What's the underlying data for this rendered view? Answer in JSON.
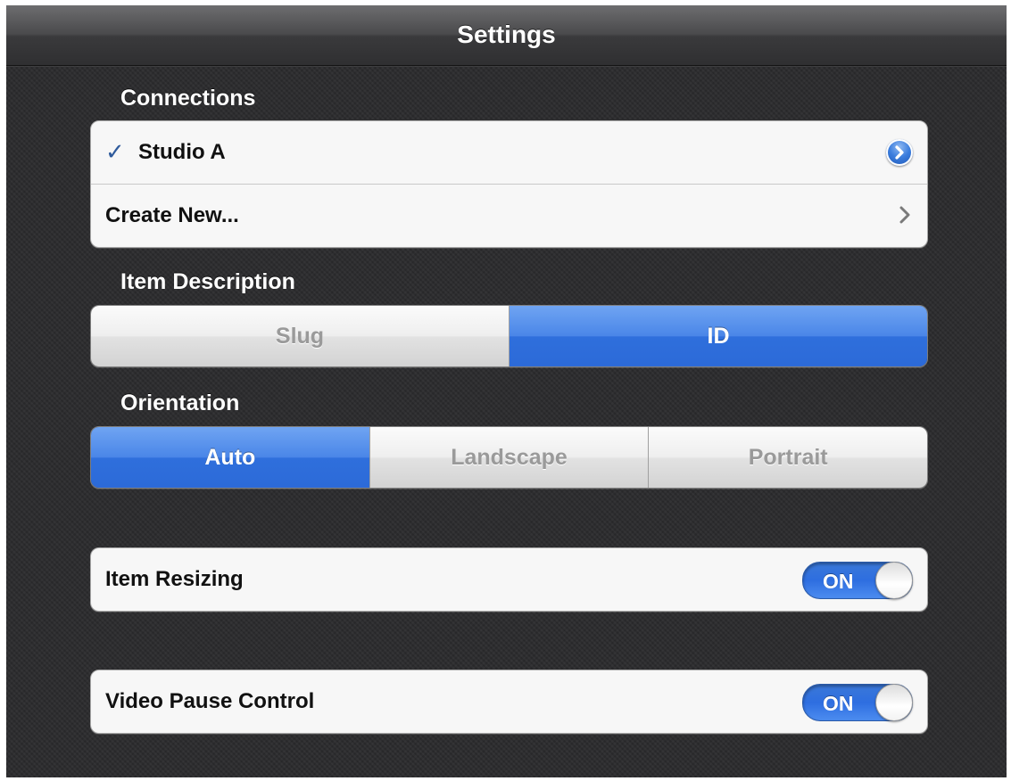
{
  "navbar": {
    "title": "Settings"
  },
  "connections": {
    "header": "Connections",
    "items": [
      {
        "label": "Studio A",
        "checked": true,
        "accessory": "detail-disclosure-icon"
      },
      {
        "label": "Create New...",
        "accessory": "chevron-right-icon"
      }
    ]
  },
  "item_description": {
    "header": "Item Description",
    "segments": [
      "Slug",
      "ID"
    ],
    "selected": "ID"
  },
  "orientation": {
    "header": "Orientation",
    "segments": [
      "Auto",
      "Landscape",
      "Portrait"
    ],
    "selected": "Auto"
  },
  "item_resizing": {
    "label": "Item Resizing",
    "toggle": "ON"
  },
  "video_pause": {
    "label": "Video Pause Control",
    "toggle": "ON"
  },
  "colors": {
    "accent_blue": "#2f6fdc",
    "background": "#2b2b2d",
    "cell": "#f7f7f7",
    "checkmark": "#2f5b9c"
  }
}
